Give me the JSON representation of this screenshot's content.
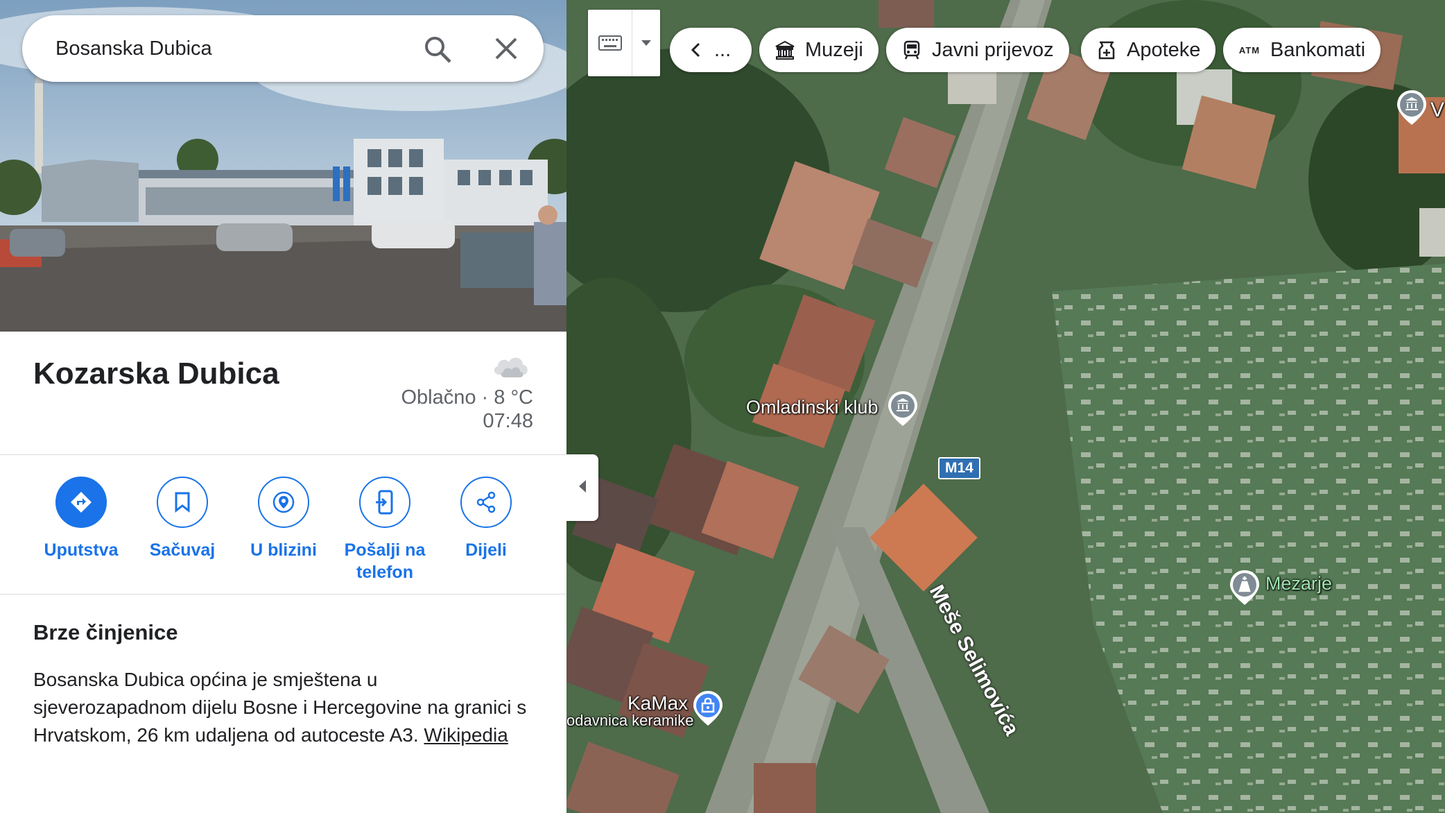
{
  "search": {
    "value": "Bosanska Dubica",
    "search_icon": "search-icon",
    "clear_icon": "close-icon"
  },
  "place": {
    "name": "Kozarska Dubica",
    "weather_icon": "cloud-icon",
    "weather_text": "Oblačno · 8 °C",
    "time": "07:48"
  },
  "actions": [
    {
      "label": "Uputstva",
      "icon": "directions-icon"
    },
    {
      "label": "Sačuvaj",
      "icon": "bookmark-icon"
    },
    {
      "label": "U blizini",
      "icon": "nearby-icon"
    },
    {
      "label": "Pošalji na telefon",
      "icon": "send-to-phone-icon"
    },
    {
      "label": "Dijeli",
      "icon": "share-icon"
    }
  ],
  "facts": {
    "heading": "Brze činjenice",
    "text": "Bosanska Dubica općina je smještena u sjeverozapadnom dijelu Bosne i Hercegovine na granici s Hrvatskom, 26 km udaljena od autoceste A3.",
    "link": "Wikipedia"
  },
  "map": {
    "chips": {
      "more": "...",
      "museums": "Muzeji",
      "transit": "Javni prijevoz",
      "pharmacies": "Apoteke",
      "atm": "Bankomati",
      "atm_badge": "ATM"
    },
    "labels": {
      "club": "Omladinski klub",
      "road_shield": "M14",
      "street": "Meše Selimovića",
      "cemetery": "Mezarje",
      "shop_name": "KaMax",
      "shop_type": "odavnica keramike",
      "edge": "V"
    }
  }
}
